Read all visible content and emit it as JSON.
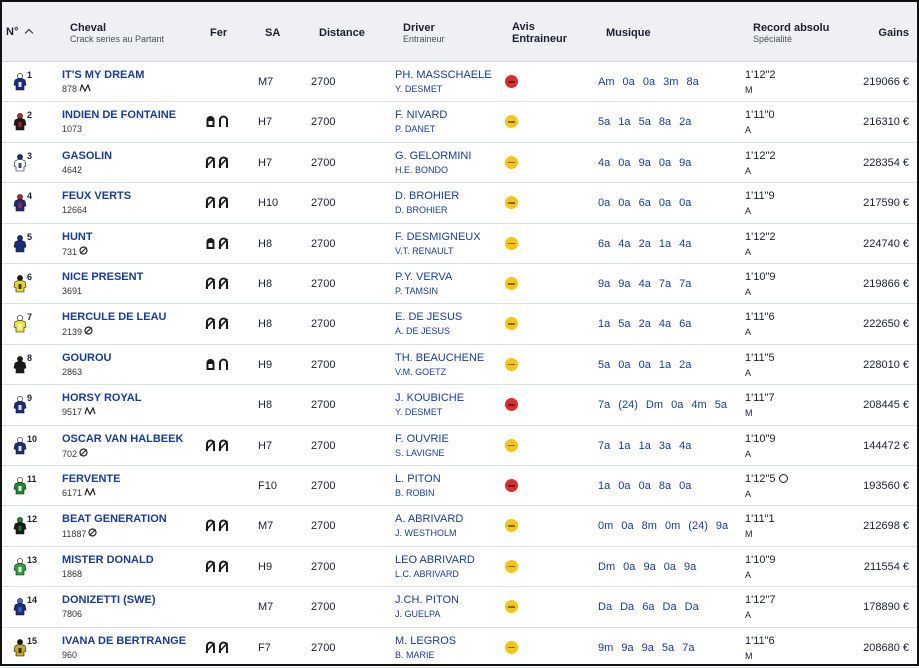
{
  "header": {
    "num": "N°",
    "cheval": "Cheval",
    "cheval_sub": "Crack series au Partant",
    "fer": "Fer",
    "sa": "SA",
    "distance": "Distance",
    "driver": "Driver",
    "driver_sub": "Entraineur",
    "avis_line1": "Avis",
    "avis_line2": "Entraineur",
    "musique": "Musique",
    "record": "Record absolu",
    "record_sub": "Spécialité",
    "gains": "Gains"
  },
  "runners": [
    {
      "num": "1",
      "name": "IT'S MY DREAM",
      "crack": "878",
      "tag": "stirrup",
      "shoes": [],
      "sa": "M7",
      "distance": "2700",
      "driver": "PH. MASSCHAELE",
      "trainer": "Y. DESMET",
      "avis": "red",
      "musique": "Am 0a 0a 3m 8a",
      "record": "1'12\"2",
      "spec": "M",
      "chrono": false,
      "gains": "219066 €",
      "jersey": "#1b2c7a",
      "jersey2": "#ffffff"
    },
    {
      "num": "2",
      "name": "INDIEN DE FONTAINE",
      "crack": "1073",
      "tag": "",
      "shoes": [
        "full",
        "open"
      ],
      "sa": "H7",
      "distance": "2700",
      "driver": "F. NIVARD",
      "trainer": "P. DANET",
      "avis": "yellow",
      "musique": "5a 1a 5a 8a 2a",
      "record": "1'11\"0",
      "spec": "A",
      "chrono": false,
      "gains": "216310 €",
      "jersey": "#1a1a1a",
      "jersey2": "#c2272d"
    },
    {
      "num": "3",
      "name": "GASOLIN",
      "crack": "4642",
      "tag": "",
      "shoes": [
        "barred",
        "barred"
      ],
      "sa": "H7",
      "distance": "2700",
      "driver": "G. GELORMINI",
      "trainer": "H.E. BONDO",
      "avis": "yellow",
      "musique": "4a 0a 9a 0a 9a",
      "record": "1'12\"2",
      "spec": "A",
      "chrono": false,
      "gains": "228354 €",
      "jersey": "#ffffff",
      "jersey2": "#1b2c7a"
    },
    {
      "num": "4",
      "name": "FEUX VERTS",
      "crack": "12664",
      "tag": "",
      "shoes": [
        "barred",
        "barred"
      ],
      "sa": "H10",
      "distance": "2700",
      "driver": "D. BROHIER",
      "trainer": "D. BROHIER",
      "avis": "yellow",
      "musique": "0a 0a 6a 0a 0a",
      "record": "1'11\"9",
      "spec": "A",
      "chrono": false,
      "gains": "217590 €",
      "jersey": "#1b2c7a",
      "jersey2": "#c2272d"
    },
    {
      "num": "5",
      "name": "HUNT",
      "crack": "731",
      "tag": "cross",
      "shoes": [
        "full",
        "barred"
      ],
      "sa": "H8",
      "distance": "2700",
      "driver": "F. DESMIGNEUX",
      "trainer": "V.T. RENAULT",
      "avis": "yellow",
      "musique": "6a 4a 2a 1a 4a",
      "record": "1'12\"2",
      "spec": "A",
      "chrono": false,
      "gains": "224740 €",
      "jersey": "#1b2c7a",
      "jersey2": "#1b2c7a"
    },
    {
      "num": "6",
      "name": "NICE PRESENT",
      "crack": "3691",
      "tag": "",
      "shoes": [
        "barred",
        "barred"
      ],
      "sa": "H8",
      "distance": "2700",
      "driver": "P.Y. VERVA",
      "trainer": "P. TAMSIN",
      "avis": "yellow",
      "musique": "9a 9a 4a 7a 7a",
      "record": "1'10\"9",
      "spec": "A",
      "chrono": false,
      "gains": "219866 €",
      "jersey": "#e7d81f",
      "jersey2": "#1a1a1a"
    },
    {
      "num": "7",
      "name": "HERCULE DE LEAU",
      "crack": "2139",
      "tag": "cross",
      "shoes": [
        "barred",
        "barred"
      ],
      "sa": "H8",
      "distance": "2700",
      "driver": "E. DE JESUS",
      "trainer": "A. DE JESUS",
      "avis": "yellow",
      "musique": "1a 5a 2a 4a 6a",
      "record": "1'11\"6",
      "spec": "A",
      "chrono": false,
      "gains": "222650 €",
      "jersey": "#f0e23a",
      "jersey2": "#ffffff"
    },
    {
      "num": "8",
      "name": "GOUROU",
      "crack": "2863",
      "tag": "",
      "shoes": [
        "full",
        "open"
      ],
      "sa": "H9",
      "distance": "2700",
      "driver": "TH. BEAUCHENE",
      "trainer": "V.M. GOETZ",
      "avis": "yellow",
      "musique": "5a 0a 0a 1a 2a",
      "record": "1'11\"5",
      "spec": "A",
      "chrono": false,
      "gains": "228010 €",
      "jersey": "#1a1a1a",
      "jersey2": "#1a1a1a"
    },
    {
      "num": "9",
      "name": "HORSY ROYAL",
      "crack": "9517",
      "tag": "stirrup",
      "shoes": [],
      "sa": "H8",
      "distance": "2700",
      "driver": "J. KOUBICHE",
      "trainer": "Y. DESMET",
      "avis": "red",
      "musique": "7a (24) Dm 0a 4m 5a",
      "record": "1'11\"7",
      "spec": "M",
      "chrono": false,
      "gains": "208445 €",
      "jersey": "#1b2c7a",
      "jersey2": "#ffffff"
    },
    {
      "num": "10",
      "name": "OSCAR VAN HALBEEK",
      "crack": "702",
      "tag": "cross",
      "shoes": [
        "barred",
        "barred"
      ],
      "sa": "H7",
      "distance": "2700",
      "driver": "F. OUVRIE",
      "trainer": "S. LAVIGNE",
      "avis": "yellow",
      "musique": "7a 1a 1a 3a 4a",
      "record": "1'10\"9",
      "spec": "A",
      "chrono": false,
      "gains": "144472 €",
      "jersey": "#1b2c7a",
      "jersey2": "#ffffff"
    },
    {
      "num": "11",
      "name": "FERVENTE",
      "crack": "6171",
      "tag": "stirrup",
      "shoes": [],
      "sa": "F10",
      "distance": "2700",
      "driver": "L. PITON",
      "trainer": "B. ROBIN",
      "avis": "red",
      "musique": "1a 0a 0a 8a 0a",
      "record": "1'12\"5",
      "spec": "A",
      "chrono": true,
      "gains": "193560 €",
      "jersey": "#1e8a2e",
      "jersey2": "#ffffff"
    },
    {
      "num": "12",
      "name": "BEAT GENERATION",
      "crack": "11887",
      "tag": "cross",
      "shoes": [
        "barred",
        "barred"
      ],
      "sa": "M7",
      "distance": "2700",
      "driver": "A. ABRIVARD",
      "trainer": "J. WESTHOLM",
      "avis": "yellow",
      "musique": "0m 0a 8m 0m (24) 9a",
      "record": "1'11\"1",
      "spec": "M",
      "chrono": false,
      "gains": "212698 €",
      "jersey": "#1a1a1a",
      "jersey2": "#1e8a2e"
    },
    {
      "num": "13",
      "name": "MISTER DONALD",
      "crack": "1868",
      "tag": "",
      "shoes": [
        "barred",
        "barred"
      ],
      "sa": "H9",
      "distance": "2700",
      "driver": "LEO ABRIVARD",
      "trainer": "L.C. ABRIVARD",
      "avis": "yellow",
      "musique": "Dm 0a 9a 0a 9a",
      "record": "1'10\"9",
      "spec": "A",
      "chrono": false,
      "gains": "211554 €",
      "jersey": "#2ea043",
      "jersey2": "#ffffff"
    },
    {
      "num": "14",
      "name": "DONIZETTI (SWE)",
      "crack": "7806",
      "tag": "",
      "shoes": [],
      "sa": "M7",
      "distance": "2700",
      "driver": "J.CH. PITON",
      "trainer": "J. GUELPA",
      "avis": "yellow",
      "musique": "Da Da 6a Da Da",
      "record": "1'12\"7",
      "spec": "A",
      "chrono": false,
      "gains": "178890 €",
      "jersey": "#1b2c7a",
      "jersey2": "#3b6fd0"
    },
    {
      "num": "15",
      "name": "IVANA DE BERTRANGE",
      "crack": "960",
      "tag": "",
      "shoes": [
        "barred",
        "barred"
      ],
      "sa": "F7",
      "distance": "2700",
      "driver": "M. LEGROS",
      "trainer": "B. MARIE",
      "avis": "yellow",
      "musique": "9m 9a 9a 5a 7a",
      "record": "1'11\"6",
      "spec": "M",
      "chrono": false,
      "gains": "208680 €",
      "jersey": "#c9a52a",
      "jersey2": "#1a1a1a"
    }
  ]
}
